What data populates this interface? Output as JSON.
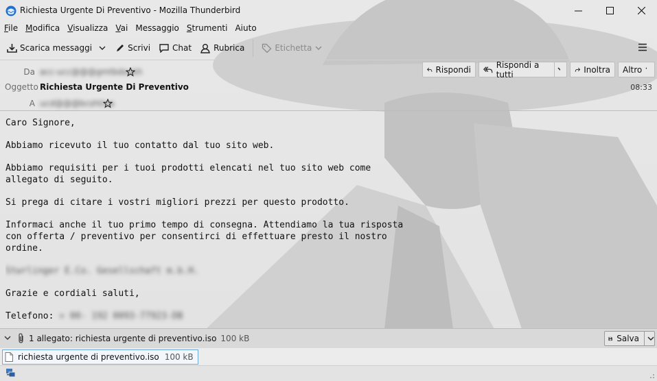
{
  "window": {
    "title": "Richiesta Urgente Di Preventivo - Mozilla Thunderbird",
    "minimize_glyph": "—",
    "maximize_glyph": "☐",
    "close_glyph": "✕"
  },
  "menu": [
    {
      "label": "File",
      "accel": "F",
      "rest": "ile"
    },
    {
      "label": "Modifica",
      "accel": "M",
      "rest": "odifica"
    },
    {
      "label": "Visualizza",
      "accel": "V",
      "rest": "isualizza"
    },
    {
      "label": "Vai",
      "accel": "V",
      "rest": "ai"
    },
    {
      "label": "Messaggio",
      "accel": "",
      "rest": "Messaggio"
    },
    {
      "label": "Strumenti",
      "accel": "S",
      "rest": "trumenti"
    },
    {
      "label": "Aiuto",
      "accel": "",
      "rest": "Aiuto"
    }
  ],
  "toolbar": {
    "get_messages": "Scarica messaggi",
    "write": "Scrivi",
    "chat": "Chat",
    "address_book": "Rubrica",
    "tag": "Etichetta"
  },
  "header": {
    "from_label": "Da",
    "from_value": "acc-ucc@@@gmtbdsukh",
    "subject_label": "Oggetto",
    "subject_value": "Richiesta Urgente Di Preventivo",
    "to_label": "A",
    "to_value": "ucd@@@bcshtiva",
    "time": "08:33",
    "reply": "Rispondi",
    "reply_all": "Rispondi a tutti",
    "forward": "Inoltra",
    "more": "Altro"
  },
  "body": {
    "paragraphs": [
      "Caro Signore,",
      "Abbiamo ricevuto il tuo contatto dal tuo sito web.",
      "Abbiamo requisiti per i tuoi prodotti elencati nel tuo sito web come\nallegato di seguito.",
      "Si prega di citare i vostri migliori prezzi per questo prodotto.",
      "Informaci anche il tuo primo tempo di consegna. Attendiamo la tua risposta\ncon offerta / preventivo per consentirci di effettuare presto il nostro\nordine."
    ],
    "signature_blurred": "Stwrlinger E.Co. Gesellschaft m.b.H.",
    "closing": "Grazie e cordiali saluti,",
    "phone_label": "Telefono:",
    "phone_blurred": "+ 00- 192 0093-77923-DB"
  },
  "attachments": {
    "summary": "1 allegato: richiesta urgente di preventivo.iso",
    "summary_size": "100 kB",
    "save_label": "Salva",
    "file_name": "richiesta urgente di preventivo.iso",
    "file_size": "100 kB"
  }
}
